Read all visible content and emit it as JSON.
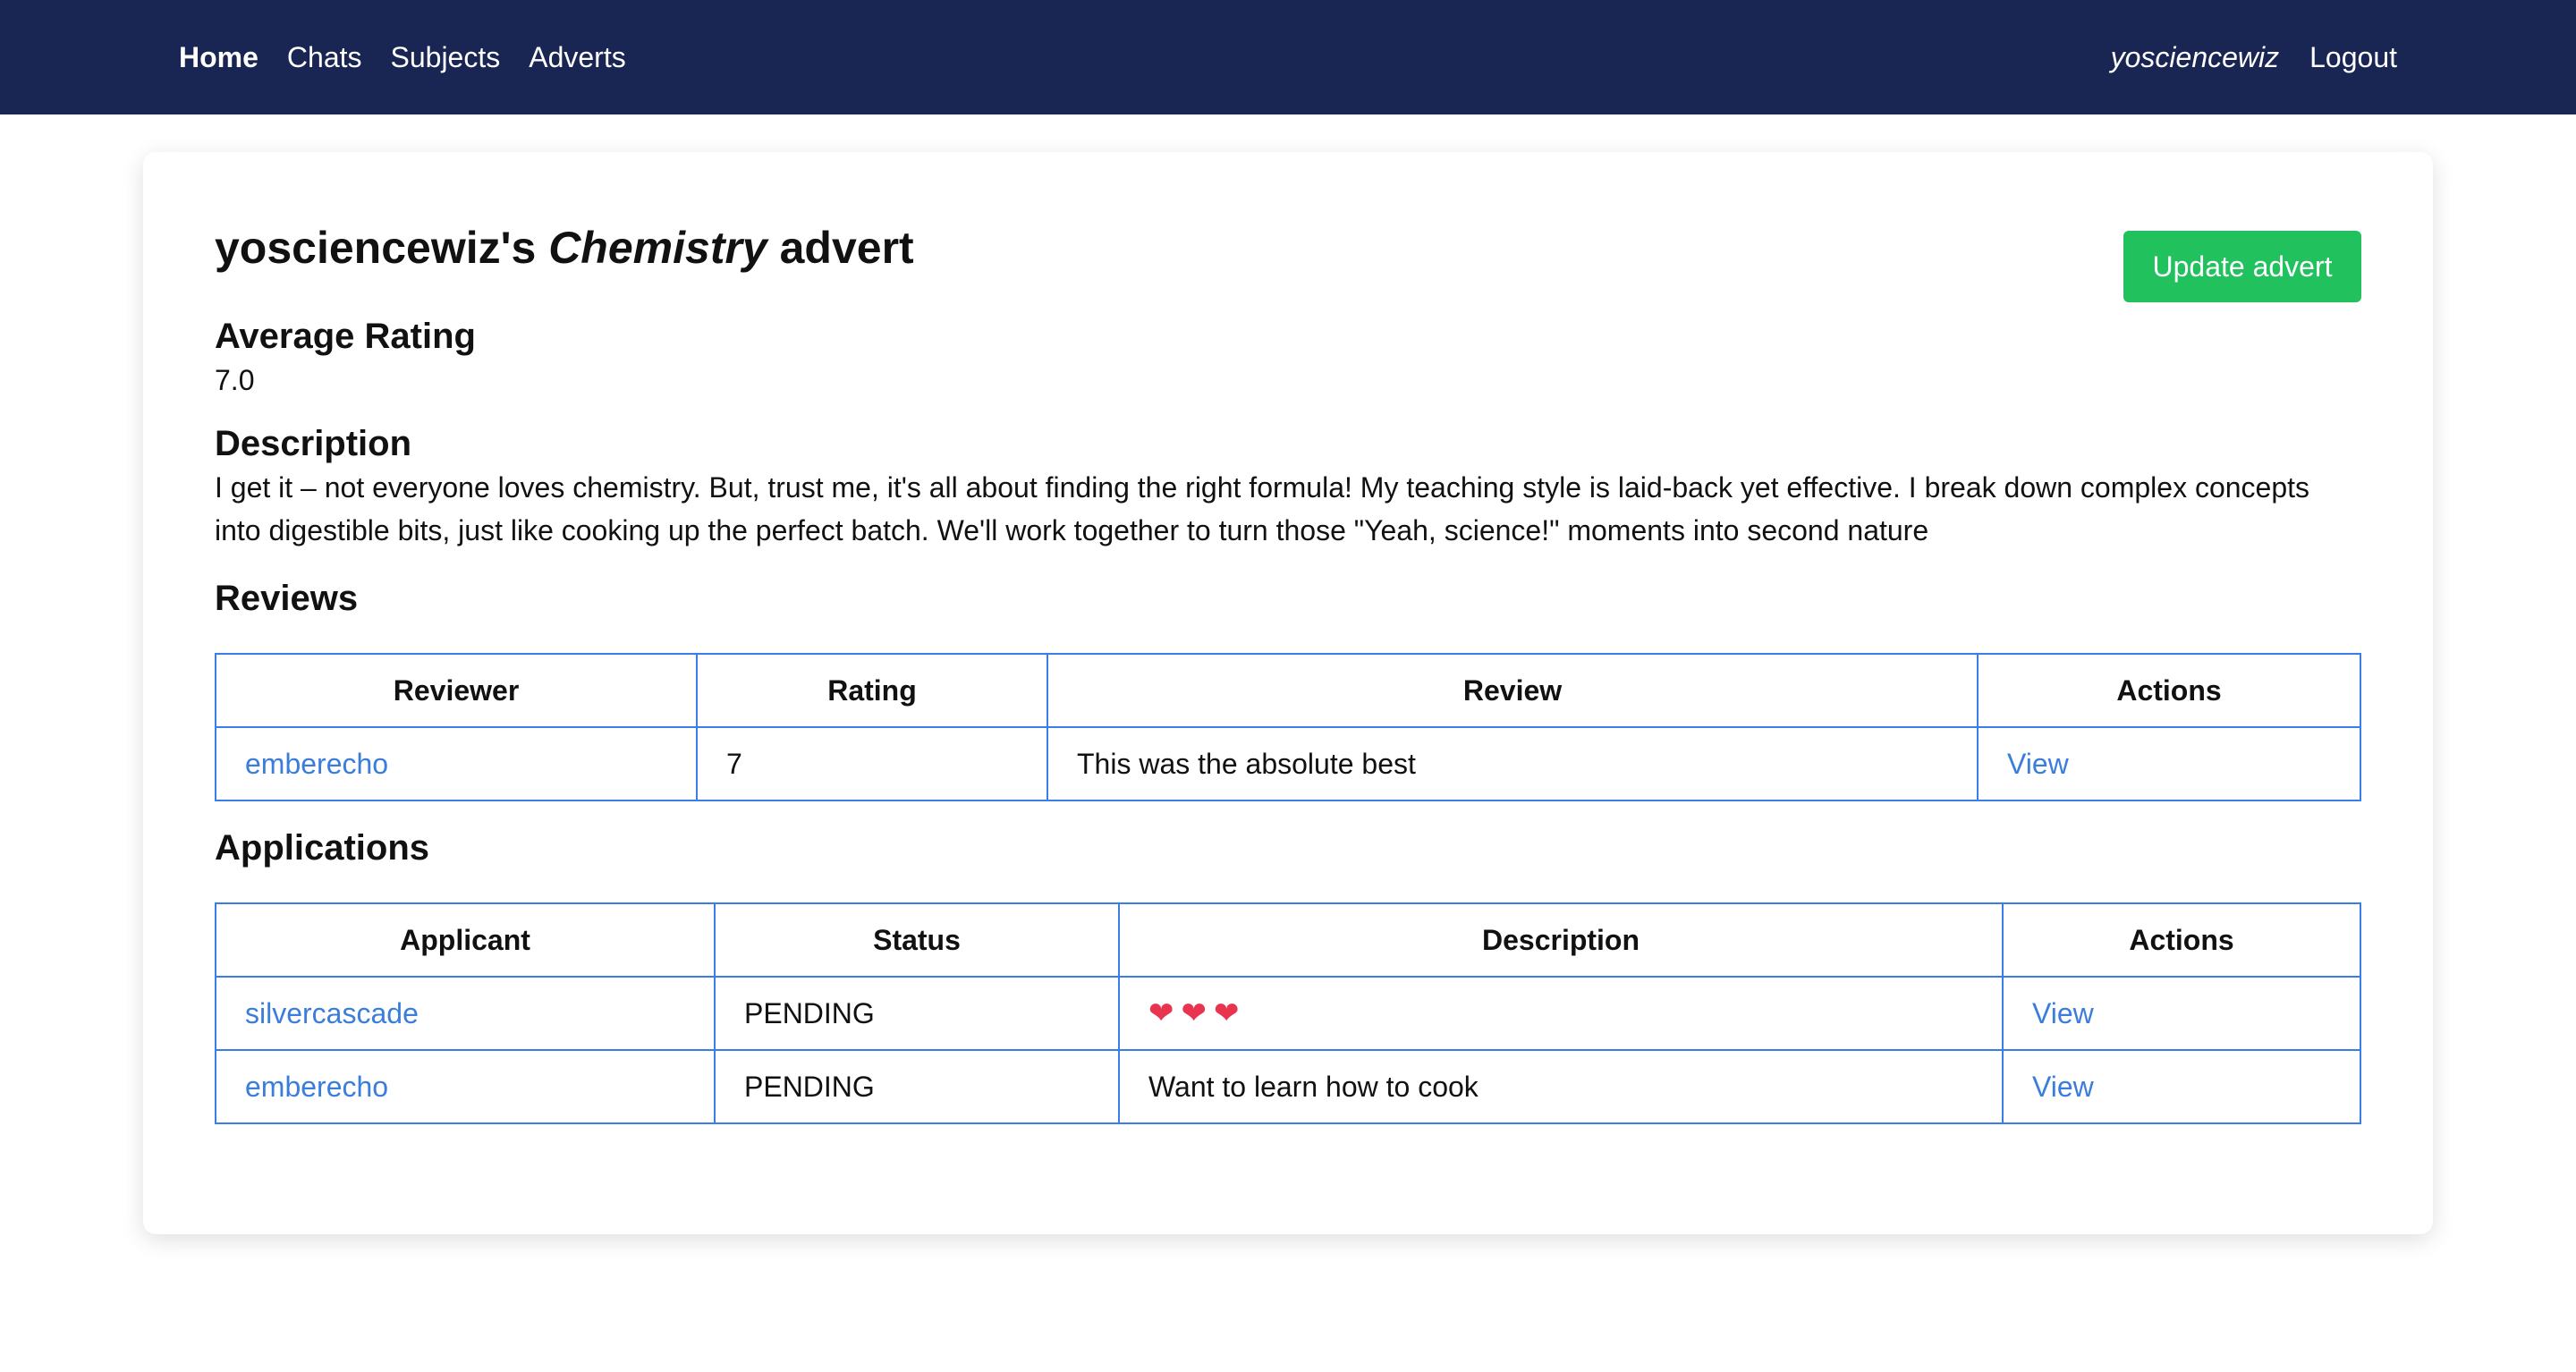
{
  "nav": {
    "links": [
      "Home",
      "Chats",
      "Subjects",
      "Adverts"
    ],
    "user": "yosciencewiz",
    "logout": "Logout"
  },
  "advert": {
    "title_owner": "yosciencewiz's ",
    "title_subject": "Chemistry",
    "title_suffix": " advert",
    "update_button": "Update advert",
    "avg_rating_heading": "Average Rating",
    "avg_rating_value": "7.0",
    "description_heading": "Description",
    "description": "I get it – not everyone loves chemistry. But, trust me, it's all about finding the right formula! My teaching style is laid-back yet effective. I break down complex concepts into digestible bits, just like cooking up the perfect batch. We'll work together to turn those \"Yeah, science!\" moments into second nature"
  },
  "reviews": {
    "heading": "Reviews",
    "columns": [
      "Reviewer",
      "Rating",
      "Review",
      "Actions"
    ],
    "rows": [
      {
        "reviewer": "emberecho",
        "rating": "7",
        "review": "This was the absolute best",
        "action": "View"
      }
    ]
  },
  "applications": {
    "heading": "Applications",
    "columns": [
      "Applicant",
      "Status",
      "Description",
      "Actions"
    ],
    "rows": [
      {
        "applicant": "silvercascade",
        "status": "PENDING",
        "description": "❤❤❤",
        "action": "View"
      },
      {
        "applicant": "emberecho",
        "status": "PENDING",
        "description": "Want to learn how to cook",
        "action": "View"
      }
    ]
  },
  "colors": {
    "navbar": "#192553",
    "accent_button": "#21c25e",
    "link": "#3a7ddb",
    "table_border": "#3b7de6"
  }
}
